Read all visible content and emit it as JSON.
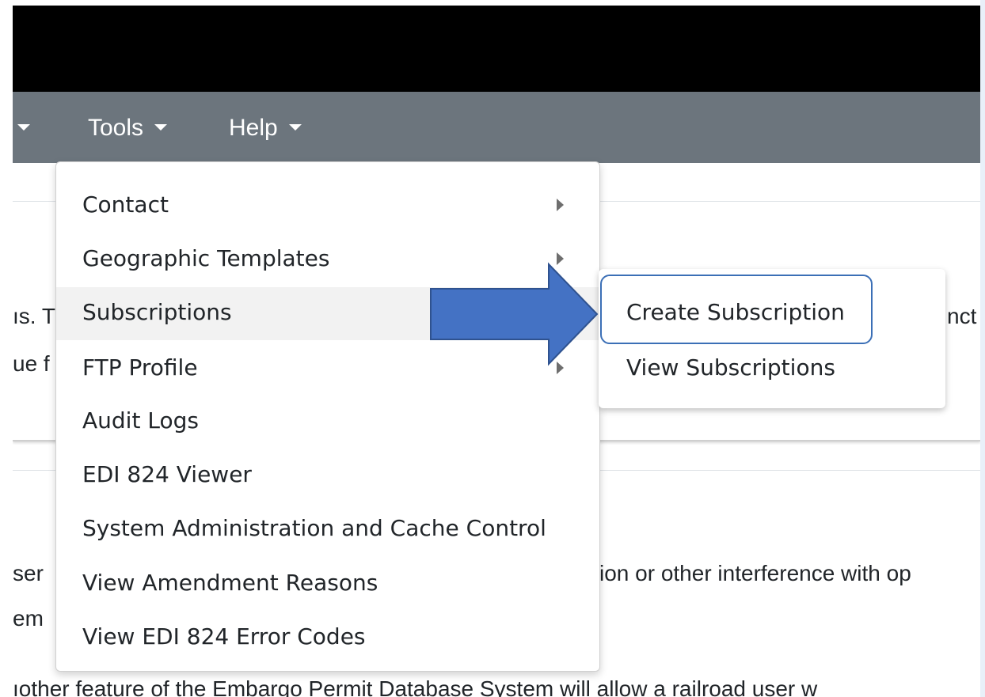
{
  "navbar": {
    "items": [
      {
        "label": "",
        "caret": true
      },
      {
        "label": "Tools",
        "caret": true
      },
      {
        "label": "Help",
        "caret": true
      }
    ]
  },
  "page_text": {
    "line1_left": "ıs. T",
    "line1_right": "nct",
    "line2_left": "ue f",
    "line3_left": "ser",
    "line3_right": "ion or other interference with op",
    "line4_left": "em",
    "line5": "ıother feature of the Embargo Permit Database System will allow a railroad user w"
  },
  "tools_menu": {
    "items": [
      {
        "label": "Contact",
        "submenu": true
      },
      {
        "label": "Geographic Templates",
        "submenu": true
      },
      {
        "label": "Subscriptions",
        "submenu": true,
        "active": true
      },
      {
        "label": "FTP Profile",
        "submenu": true
      },
      {
        "label": "Audit Logs",
        "submenu": false
      },
      {
        "label": "EDI 824 Viewer",
        "submenu": false
      },
      {
        "label": "System Administration and Cache Control",
        "submenu": false
      },
      {
        "label": "View Amendment Reasons",
        "submenu": false
      },
      {
        "label": "View EDI 824 Error Codes",
        "submenu": false
      }
    ]
  },
  "subscriptions_submenu": {
    "items": [
      {
        "label": "Create Subscription",
        "highlighted": true
      },
      {
        "label": "View Subscriptions"
      }
    ]
  },
  "colors": {
    "navbar_bg": "#6c757d",
    "annotation_arrow": "#4472c4",
    "highlight_border": "#3b6fb6"
  },
  "icons": [
    "caret-down-icon",
    "chevron-right-icon",
    "annotation-arrow-icon"
  ]
}
